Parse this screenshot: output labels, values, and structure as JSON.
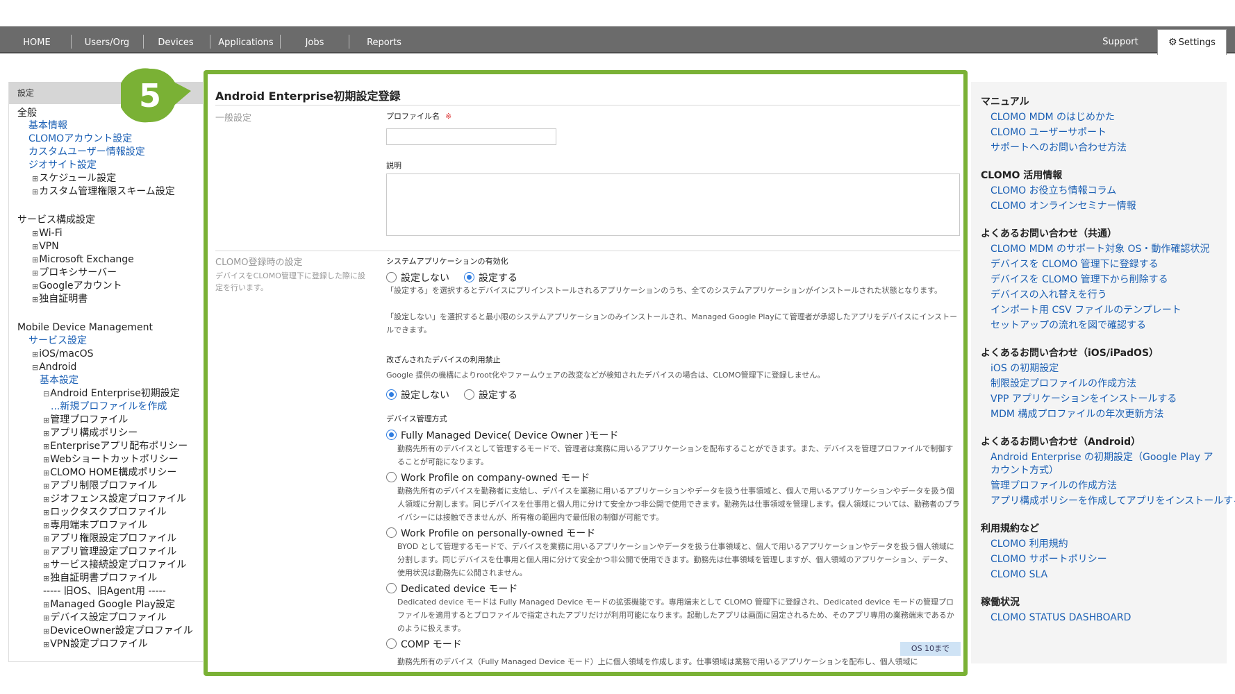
{
  "nav": {
    "items": [
      "HOME",
      "Users/Org",
      "Devices",
      "Applications",
      "Jobs",
      "Reports"
    ],
    "support": "Support",
    "settings": "Settings"
  },
  "sidebar": {
    "header": "設定",
    "lines": [
      {
        "text": "全般",
        "kind": "group"
      },
      {
        "text": "基本情報",
        "kind": "link"
      },
      {
        "text": "CLOMOアカウント設定",
        "kind": "link"
      },
      {
        "text": "カスタムユーザー情報設定",
        "kind": "link"
      },
      {
        "text": "ジオサイト設定",
        "kind": "link"
      },
      {
        "text": "スケジュール設定",
        "kind": "plus"
      },
      {
        "text": "カスタム管理権限スキーム設定",
        "kind": "plus"
      },
      {
        "text": "サービス構成設定",
        "kind": "group"
      },
      {
        "text": "Wi-Fi",
        "kind": "plus"
      },
      {
        "text": "VPN",
        "kind": "plus"
      },
      {
        "text": "Microsoft Exchange",
        "kind": "plus"
      },
      {
        "text": "プロキシサーバー",
        "kind": "plus"
      },
      {
        "text": "Googleアカウント",
        "kind": "plus"
      },
      {
        "text": "独自証明書",
        "kind": "plus"
      },
      {
        "text": "Mobile Device Management",
        "kind": "group"
      },
      {
        "text": "サービス設定",
        "kind": "link"
      },
      {
        "text": "iOS/macOS",
        "kind": "plus"
      },
      {
        "text": "Android",
        "kind": "minus"
      },
      {
        "text": "基本設定",
        "kind": "link"
      },
      {
        "text": "Android Enterprise初期設定",
        "kind": "minus"
      },
      {
        "text": "...新規プロファイルを作成",
        "kind": "link"
      },
      {
        "text": "管理プロファイル",
        "kind": "plus"
      },
      {
        "text": "アプリ構成ポリシー",
        "kind": "plus"
      },
      {
        "text": "Enterpriseアプリ配布ポリシー",
        "kind": "plus"
      },
      {
        "text": "Webショートカットポリシー",
        "kind": "plus"
      },
      {
        "text": "CLOMO HOME構成ポリシー",
        "kind": "plus"
      },
      {
        "text": "アプリ制限プロファイル",
        "kind": "plus"
      },
      {
        "text": "ジオフェンス設定プロファイル",
        "kind": "plus"
      },
      {
        "text": "ロックタスクプロファイル",
        "kind": "plus"
      },
      {
        "text": "専用端末プロファイル",
        "kind": "plus"
      },
      {
        "text": "アプリ権限設定プロファイル",
        "kind": "plus"
      },
      {
        "text": "アプリ管理設定プロファイル",
        "kind": "plus"
      },
      {
        "text": "サービス接続設定プロファイル",
        "kind": "plus"
      },
      {
        "text": "独自証明書プロファイル",
        "kind": "plus"
      },
      {
        "text": "----- 旧OS、旧Agent用 -----",
        "kind": "plain"
      },
      {
        "text": "Managed Google Play設定",
        "kind": "plus"
      },
      {
        "text": "デバイス設定プロファイル",
        "kind": "plus"
      },
      {
        "text": "DeviceOwner設定プロファイル",
        "kind": "plus"
      },
      {
        "text": "VPN設定プロファイル",
        "kind": "plus"
      }
    ]
  },
  "main": {
    "step_number": "5",
    "title": "Android Enterprise初期設定登録",
    "general_section": "一般設定",
    "profile_name_label": "プロファイル名",
    "required_mark": "※",
    "description_label": "説明",
    "clomo_section": "CLOMO登録時の設定",
    "clomo_section_desc": "デバイスをCLOMO管理下に登録した際に設定を行います。",
    "system_apps": {
      "label": "システムアプリケーションの有効化",
      "opt_off": "設定しない",
      "opt_on": "設定する",
      "selected": "on",
      "help1": "「設定する」を選択するとデバイスにプリインストールされるアプリケーションのうち、全てのシステムアプリケーションがインストールされた状態となります。",
      "help2": "「設定しない」を選択すると最小限のシステムアプリケーションのみインストールされ、Managed Google Playにて管理者が承認したアプリをデバイスにインストールできます。"
    },
    "tamper": {
      "label": "改ざんされたデバイスの利用禁止",
      "help": "Google 提供の機構によりroot化やファームウェアの改変などが検知されたデバイスの場合は、CLOMO管理下に登録しません。",
      "opt_off": "設定しない",
      "opt_on": "設定する",
      "selected": "off"
    },
    "mode": {
      "label": "デバイス管理方式",
      "options": [
        {
          "title": "Fully Managed Device( Device Owner )モード",
          "selected": true,
          "help": "勤務先所有のデバイスとして管理するモードで、管理者は業務に用いるアプリケーションを配布することができます。また、デバイスを管理プロファイルで制御することが可能になります。"
        },
        {
          "title": "Work Profile on company-owned モード",
          "selected": false,
          "help": "勤務先所有のデバイスを勤務者に支給し、デバイスを業務に用いるアプリケーションやデータを扱う仕事領域と、個人で用いるアプリケーションやデータを扱う個人領域に分割します。同じデバイスを仕事用と個人用に分けて安全かつ非公開で使用できます。勤務先は仕事領域を管理します。個人領域については、勤務者のプライバシーには接触できませんが、所有権の範囲内で最低限の制御が可能です。"
        },
        {
          "title": "Work Profile on personally-owned モード",
          "selected": false,
          "help": "BYOD として管理するモードで、デバイスを業務に用いるアプリケーションやデータを扱う仕事領域と、個人で用いるアプリケーションやデータを扱う個人領域に分割します。同じデバイスを仕事用と個人用に分けて安全かつ非公開で使用できます。勤務先は仕事領域を管理しますが、個人領域のアプリケーション、データ、使用状況は勤務先に公開されません。"
        },
        {
          "title": "Dedicated device モード",
          "selected": false,
          "help": "Dedicated device モードは Fully Managed Device モードの拡張機能です。専用端末として CLOMO 管理下に登録され、Dedicated device モードの管理プロファイルを適用するとプロファイルで指定されたアプリだけが利用可能になります。起動したアプリは画面に固定されるため、そのアプリ専用の業務端末であるかのように扱えます。"
        },
        {
          "title": "COMP モード",
          "selected": false,
          "help": "勤務先所有のデバイス（Fully Managed Device モード）上に個人領域を作成します。仕事領域は業務で用いるアプリケーションを配布し、個人領域に"
        }
      ],
      "os_badge": "OS 10まで"
    }
  },
  "right": {
    "sections": [
      {
        "heading": "マニュアル",
        "links": [
          "CLOMO MDM のはじめかた",
          "CLOMO ユーザーサポート",
          "サポートへのお問い合わせ方法"
        ]
      },
      {
        "heading": "CLOMO 活用情報",
        "links": [
          "CLOMO お役立ち情報コラム",
          "CLOMO オンラインセミナー情報"
        ]
      },
      {
        "heading": "よくあるお問い合わせ（共通）",
        "links": [
          "CLOMO MDM のサポート対象 OS・動作確認状況",
          "デバイスを CLOMO 管理下に登録する",
          "デバイスを CLOMO 管理下から削除する",
          "デバイスの入れ替えを行う",
          "インポート用 CSV ファイルのテンプレート",
          "セットアップの流れを図で確認する"
        ]
      },
      {
        "heading": "よくあるお問い合わせ（iOS/iPadOS）",
        "links": [
          "iOS の初期設定",
          "制限設定プロファイルの作成方法",
          "VPP アプリケーションをインストールする",
          "MDM 構成プロファイルの年次更新方法"
        ]
      },
      {
        "heading": "よくあるお問い合わせ（Android）",
        "links": [
          "Android Enterprise の初期設定（Google Play アカウント方式）",
          "管理プロファイルの作成方法",
          "アプリ構成ポリシーを作成してアプリをインストールする"
        ]
      },
      {
        "heading": "利用規約など",
        "links": [
          "CLOMO 利用規約",
          "CLOMO サポートポリシー",
          "CLOMO SLA"
        ]
      },
      {
        "heading": "稼働状況",
        "links": [
          "CLOMO STATUS DASHBOARD"
        ]
      }
    ]
  },
  "colors": {
    "accent_green": "#7ab135",
    "link_blue": "#1a5fb4",
    "nav_gray": "#6b6b6b"
  }
}
